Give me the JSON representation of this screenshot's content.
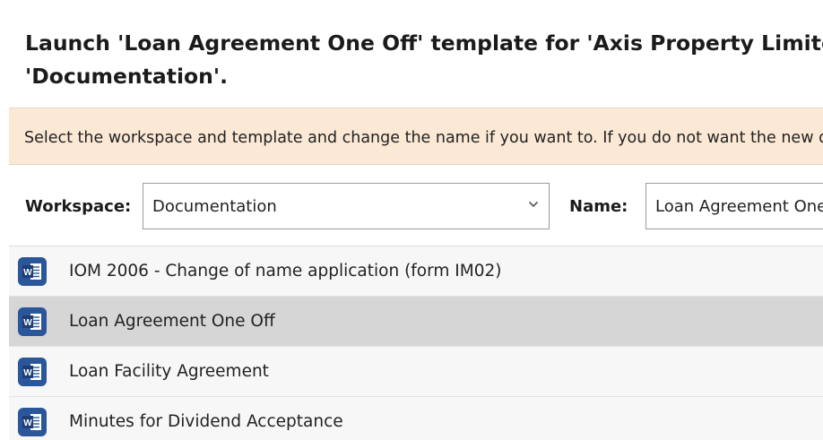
{
  "dialog": {
    "title_line1": "Launch 'Loan Agreement One Off' template for 'Axis Property Limited' in",
    "title_line2": "'Documentation'.",
    "info_message": "Select the workspace and template and change the name if you want to. If you do not want the new document to be"
  },
  "form": {
    "workspace_label": "Workspace:",
    "workspace_value": "Documentation",
    "name_label": "Name:",
    "name_value": "Loan Agreement One Off"
  },
  "templates": [
    {
      "label": "IOM 2006 - Change of name application (form IM02)",
      "icon": "word-document-icon",
      "selected": false
    },
    {
      "label": "Loan Agreement One Off",
      "icon": "word-document-icon",
      "selected": true
    },
    {
      "label": "Loan Facility Agreement",
      "icon": "word-document-icon",
      "selected": false
    },
    {
      "label": "Minutes for Dividend Acceptance",
      "icon": "word-document-icon",
      "selected": false
    }
  ],
  "colors": {
    "info_bar_bg": "#fbe9d6",
    "selected_row_bg": "#d6d6d6",
    "word_icon_blue": "#2b579a"
  }
}
